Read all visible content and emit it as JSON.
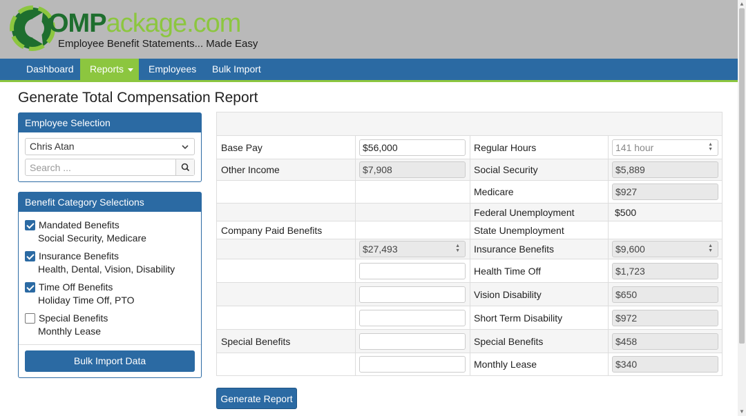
{
  "header": {
    "logo_dark": "OMP",
    "logo_light": "ackage.com",
    "tagline": "Employee Benefit Statements... Made Easy",
    "colors": {
      "header_bg": "#b9b9b9",
      "logo_green": "#8cc63f",
      "logo_dark_green": "#1e6e2e"
    }
  },
  "nav": {
    "items": [
      {
        "label": "Dashboard",
        "active": false
      },
      {
        "label": "Reports",
        "active": true,
        "dropdown": true
      },
      {
        "label": "Employees",
        "active": false
      },
      {
        "label": "Bulk Import",
        "active": false
      }
    ],
    "colors": {
      "bar": "#2b6aa3",
      "active": "#8cc63f"
    }
  },
  "page_title": "Generate Total Compensation Report",
  "employee_panel": {
    "heading": "Employee Selection",
    "selected_employee": "Chris Atan",
    "search_placeholder": "Search ...",
    "icons": {
      "dropdown": "chevron-down-icon",
      "search": "search-icon"
    }
  },
  "benefit_panel": {
    "heading": "Benefit Category Selections",
    "categories": [
      {
        "label": "Mandated Benefits",
        "description": "Social Security, Medicare",
        "checked": true
      },
      {
        "label": "Insurance Benefits",
        "description": "Health, Dental, Vision, Disability",
        "checked": true
      },
      {
        "label": "Time Off Benefits",
        "description": "Holiday Time Off, PTO",
        "checked": true
      },
      {
        "label": "Special Benefits",
        "description": "Monthly Lease",
        "checked": false
      }
    ],
    "bulk_import_button": "Bulk Import Data"
  },
  "grid": {
    "left": {
      "base_pay_label": "Base Pay",
      "base_pay_value": "$56,000",
      "other_income_label": "Other Income",
      "other_income_value": "$7,908",
      "company_paid_label": "Company Paid Benefits",
      "company_paid_value": "$27,493",
      "special_benefits_label": "Special Benefits",
      "empty_fields": [
        "",
        "",
        "",
        "",
        ""
      ]
    },
    "right": {
      "regular_hours_label": "Regular Hours",
      "regular_hours_value": "141 hour",
      "social_security_label": "Social Security",
      "social_security_value": "$5,889",
      "medicare_label": "Medicare",
      "medicare_value": "$927",
      "federal_unemployment_label": "Federal Unemployment",
      "federal_unemployment_value": "$500",
      "state_unemployment_label": "State Unemployment",
      "insurance_benefits_label": "Insurance Benefits",
      "insurance_benefits_value": "$9,600",
      "health_time_off_label": "Health Time Off",
      "health_time_off_value": "$1,723",
      "vision_disability_label": "Vision Disability",
      "vision_disability_value": "$650",
      "short_term_disability_label": "Short Term Disability",
      "short_term_disability_value": "$972",
      "special_benefits_label": "Special Benefits",
      "special_benefits_value": "$458",
      "monthly_lease_label": "Monthly Lease",
      "monthly_lease_value": "$340"
    }
  },
  "generate_button": "Generate Report"
}
